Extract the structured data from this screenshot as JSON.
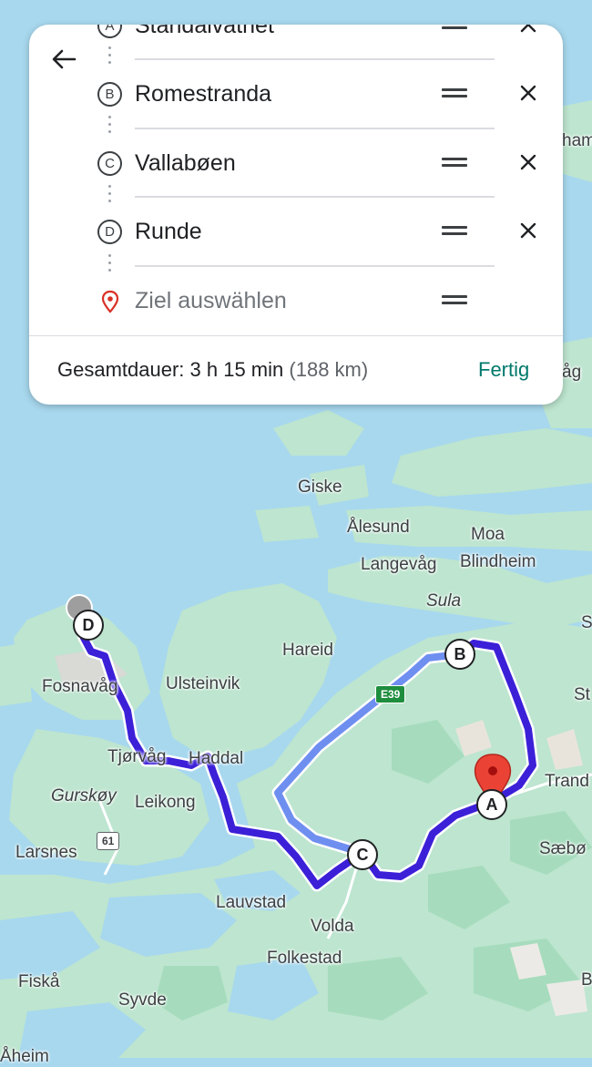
{
  "panel": {
    "stops": [
      {
        "letter": "A",
        "name": "Standalvatnet"
      },
      {
        "letter": "B",
        "name": "Romestranda"
      },
      {
        "letter": "C",
        "name": "Vallabøen"
      },
      {
        "letter": "D",
        "name": "Runde"
      }
    ],
    "destination_placeholder": "Ziel auswählen",
    "summary_label": "Gesamtdauer:",
    "summary_duration": "3 h 15 min",
    "summary_distance": "(188 km)",
    "done_label": "Fertig"
  },
  "map": {
    "places": {
      "giske": "Giske",
      "alesund": "Ålesund",
      "moa": "Moa",
      "langevag": "Langevåg",
      "blindheim": "Blindheim",
      "sula": "Sula",
      "hareid": "Hareid",
      "fosnavag": "Fosnavåg",
      "ulsteinvik": "Ulsteinvik",
      "tjorvag": "Tjørvåg",
      "haddal": "Haddal",
      "gurskoy": "Gurskøy",
      "leikong": "Leikong",
      "larsnes": "Larsnes",
      "lauvstad": "Lauvstad",
      "volda": "Volda",
      "folkestad": "Folkestad",
      "fiska": "Fiskå",
      "syvde": "Syvde",
      "sæbo": "Sæbø",
      "trand": "Trand",
      "aheim": "Åheim",
      "edge_ham": "ham",
      "edge_ag": "åg",
      "edge_s": "S",
      "edge_st": "St",
      "edge_b": "B"
    },
    "route_badges": {
      "e39": "E39",
      "r61": "61"
    },
    "markers": {
      "a": "A",
      "b": "B",
      "c": "C",
      "d": "D"
    },
    "colors": {
      "water": "#a8d8ee",
      "land": "#bde5cf",
      "land_dark": "#a6dcbd",
      "route_primary": "#3b20d8",
      "route_alt": "#6f8ff0",
      "pin": "#ea4335"
    }
  }
}
